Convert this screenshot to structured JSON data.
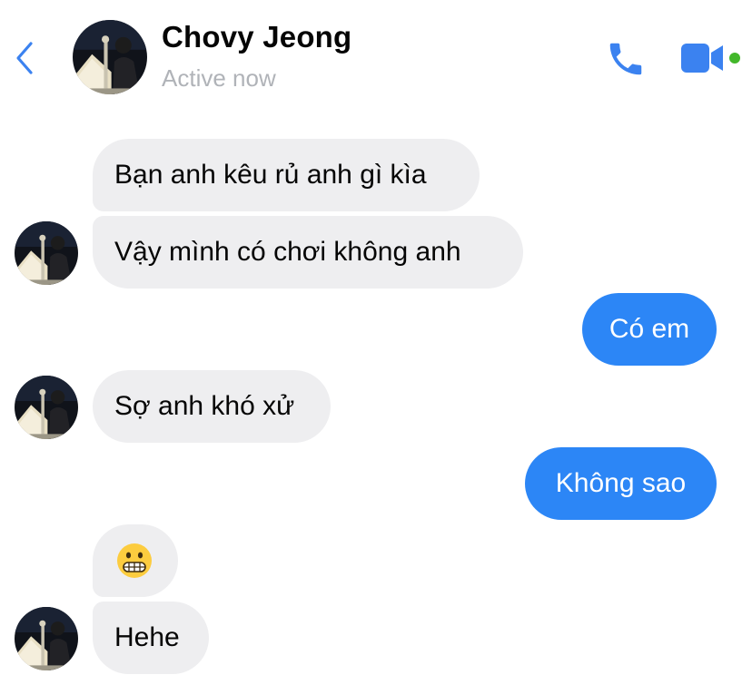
{
  "header": {
    "contact_name": "Chovy Jeong",
    "status": "Active now",
    "icons": {
      "back": "chevron-left-icon",
      "call": "phone-icon",
      "video": "video-camera-icon",
      "online": "online-indicator"
    }
  },
  "colors": {
    "accent": "#3b82f0",
    "outgoing_bubble": "#2c86f6",
    "incoming_bubble": "#eeeef0",
    "online_dot": "#42b72a",
    "status_text": "#b0b3b8"
  },
  "messages": [
    {
      "direction": "incoming",
      "text": "Bạn anh kêu rủ anh gì kìa"
    },
    {
      "direction": "incoming",
      "text": "Vậy mình có chơi không anh"
    },
    {
      "direction": "outgoing",
      "text": "Có em"
    },
    {
      "direction": "incoming",
      "text": "Sợ anh khó xử"
    },
    {
      "direction": "outgoing",
      "text": "Không sao"
    },
    {
      "direction": "incoming",
      "emoji": "grimacing-face-emoji"
    },
    {
      "direction": "incoming",
      "text": "Hehe"
    }
  ]
}
